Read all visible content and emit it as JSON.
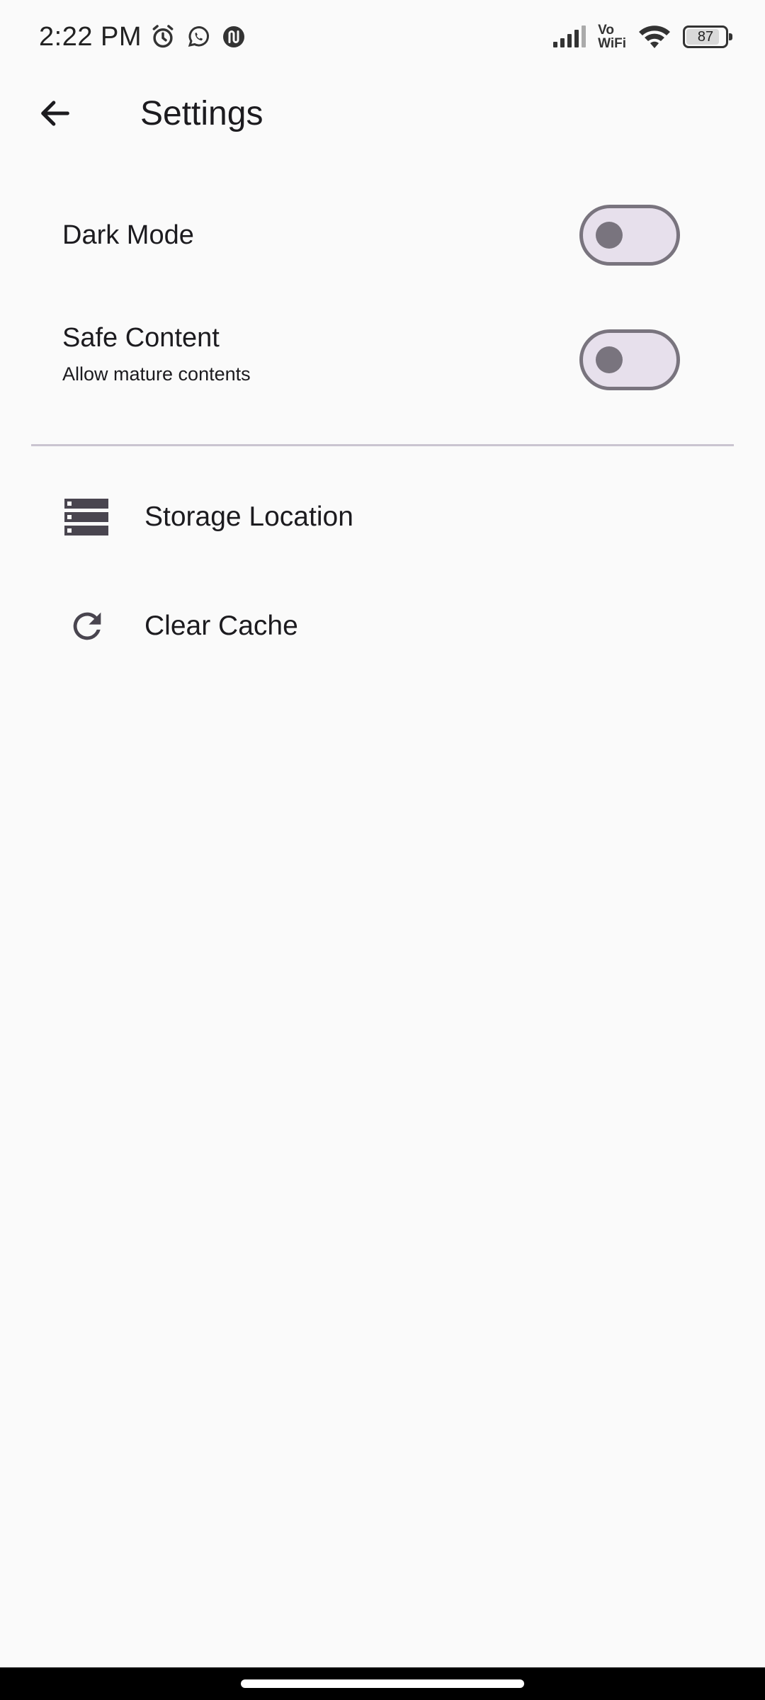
{
  "status_bar": {
    "time": "2:22 PM",
    "icons": [
      "alarm-icon",
      "whatsapp-icon",
      "app-notification-icon"
    ],
    "vowifi_top": "Vo",
    "vowifi_bottom": "WiFi",
    "battery_percent": 87
  },
  "app_bar": {
    "back_icon": "arrow-left-icon",
    "title": "Settings"
  },
  "settings": {
    "dark_mode": {
      "title": "Dark Mode",
      "enabled": false
    },
    "safe_content": {
      "title": "Safe Content",
      "subtitle": "Allow mature contents",
      "enabled": false
    }
  },
  "list": {
    "storage": {
      "label": "Storage Location",
      "icon": "storage-icon"
    },
    "cache": {
      "label": "Clear Cache",
      "icon": "refresh-icon"
    }
  },
  "colors": {
    "background": "#fafafa",
    "switch_track": "#e7e0ec",
    "switch_outline": "#79747e",
    "divider": "#cac4d0",
    "icon": "#49454f"
  }
}
